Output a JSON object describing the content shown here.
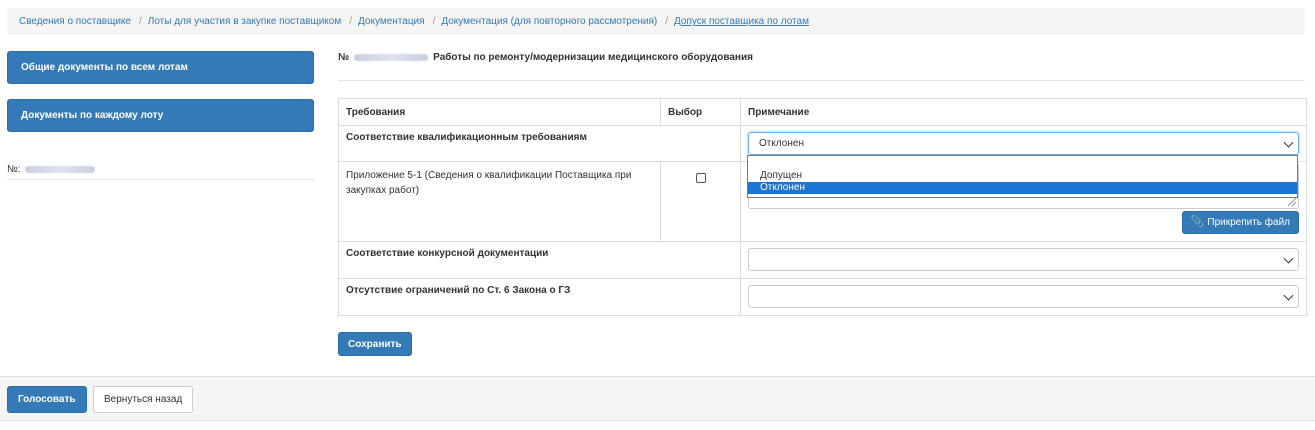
{
  "breadcrumb": [
    {
      "label": "Сведения о поставщике"
    },
    {
      "label": "Лоты для участия в закупке поставщиком"
    },
    {
      "label": "Документация"
    },
    {
      "label": "Документация (для повторного рассмотрения)"
    },
    {
      "label": "Допуск поставщика по лотам"
    }
  ],
  "sidebar": {
    "common_docs": "Общие документы по всем лотам",
    "per_lot_docs": "Документы по каждому лоту",
    "number_label": "№:"
  },
  "lot": {
    "number_sign": "№",
    "name": "Работы по ремонту/модернизации медицинского оборудования"
  },
  "table": {
    "headers": {
      "requirements": "Требования",
      "selection": "Выбор",
      "note": "Примечание"
    },
    "groups": [
      {
        "title": "Соответствие квалификационным требованиям",
        "selected": "Отклонен"
      },
      {
        "title": "Соответствие конкурсной документации",
        "selected": ""
      },
      {
        "title": "Отсутствие ограничений по Ст. 6 Закона о ГЗ",
        "selected": ""
      }
    ],
    "subitem": {
      "label": "Приложение 5-1 (Сведения о квалификации Поставщика при закупках работ)",
      "checked": false,
      "attach_label": "Прикрепить файл"
    }
  },
  "dropdown": {
    "options": [
      "",
      "Допущен",
      "Отклонен"
    ],
    "highlighted": "Отклонен"
  },
  "actions": {
    "save": "Сохранить",
    "vote": "Голосовать",
    "back": "Вернуться назад"
  },
  "colors": {
    "primary": "#337ab7",
    "link": "#337ab7",
    "highlight": "#1e74d4"
  }
}
